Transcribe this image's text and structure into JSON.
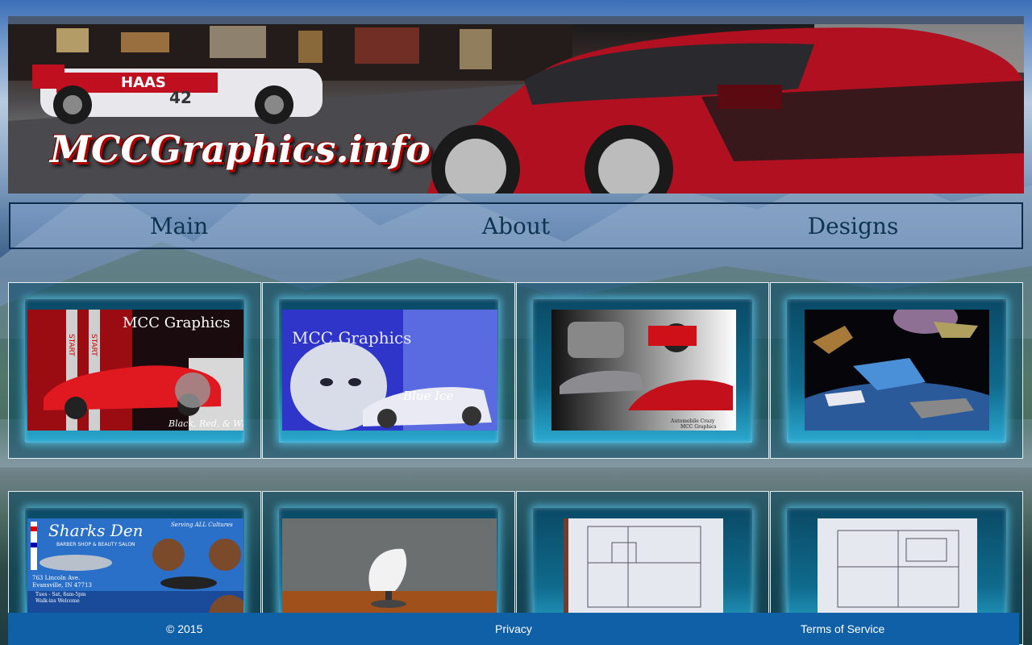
{
  "banner": {
    "title": "MCCGraphics.info",
    "car_number": "42",
    "team_text": "HAAS"
  },
  "nav": {
    "items": [
      {
        "label": "Main"
      },
      {
        "label": "About"
      },
      {
        "label": "Designs"
      }
    ]
  },
  "gallery": {
    "row1": [
      {
        "title": "MCC Graphics",
        "caption": "Black, Red, & White",
        "side_text": "START"
      },
      {
        "title": "MCC Graphics",
        "caption": "Blue Ice"
      },
      {
        "caption_line1": "Automobile Crazy",
        "caption_line2": "MCC Graphics"
      },
      {}
    ],
    "row2": [
      {
        "title": "Sharks Den",
        "subtitle": "BARBER SHOP & BEAUTY SALON",
        "tagline": "Serving ALL Cultures",
        "address_line1": "763 Lincoln Ave.",
        "address_line2": "Evansville, IN 47713",
        "hours": "Tues - Sat, 8am-5pm",
        "walkins": "Walk-ins Welcome"
      },
      {},
      {},
      {}
    ]
  },
  "footer": {
    "copyright": "© 2015",
    "privacy": "Privacy",
    "terms": "Terms of Service"
  },
  "colors": {
    "nav_text": "#0d3550",
    "footer_bg": "#1060a8",
    "frame_glow": "#5ac8f0"
  }
}
